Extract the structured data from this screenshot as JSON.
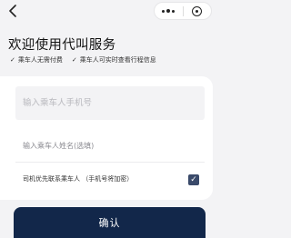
{
  "nav": {
    "back_icon": "chevron-left-icon",
    "menu_icon": "more-dots-icon",
    "close_icon": "target-circle-icon"
  },
  "header": {
    "title": "欢迎使用代叫服务",
    "tips": [
      {
        "icon": "check-icon",
        "text": "乘车人无需付费"
      },
      {
        "icon": "check-icon",
        "text": "乘车人可实时查看行程信息"
      }
    ]
  },
  "form": {
    "phone_placeholder": "输入乘车人手机号",
    "name_placeholder": "输入乘车人姓名(选填)",
    "contact_preference_label": "司机优先联系乘车人 （手机号将加密）",
    "contact_preference_checked": true
  },
  "actions": {
    "confirm_label": "确认"
  },
  "colors": {
    "primary": "#12274a",
    "checkbox": "#3a4a6a",
    "background": "#f3f3f5"
  }
}
